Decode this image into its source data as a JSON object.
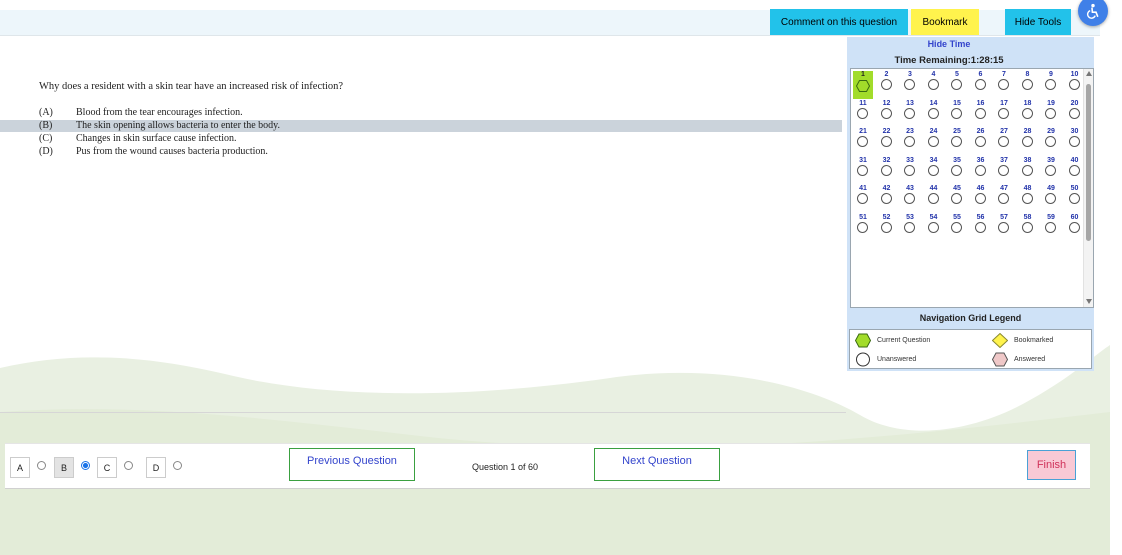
{
  "toolbar": {
    "comment_label": "Comment on this question",
    "bookmark_label": "Bookmark",
    "hide_tools_label": "Hide Tools"
  },
  "question": {
    "text": "Why does a resident with a skin tear have an increased risk of infection?",
    "options": [
      {
        "letter": "(A)",
        "text": "Blood from the tear encourages infection.",
        "selected": false
      },
      {
        "letter": "(B)",
        "text": "The skin opening allows bacteria to enter the body.",
        "selected": true
      },
      {
        "letter": "(C)",
        "text": "Changes in skin surface cause infection.",
        "selected": false
      },
      {
        "letter": "(D)",
        "text": "Pus from the wound causes bacteria production.",
        "selected": false
      }
    ]
  },
  "timer": {
    "hide_label": "Hide Time",
    "remaining_label": "Time Remaining:1:28:15"
  },
  "nav_grid": {
    "numbers": [
      "1",
      "2",
      "3",
      "4",
      "5",
      "6",
      "7",
      "8",
      "9",
      "10",
      "11",
      "12",
      "13",
      "14",
      "15",
      "16",
      "17",
      "18",
      "19",
      "20",
      "21",
      "22",
      "23",
      "24",
      "25",
      "26",
      "27",
      "28",
      "29",
      "30",
      "31",
      "32",
      "33",
      "34",
      "35",
      "36",
      "37",
      "38",
      "39",
      "40",
      "41",
      "42",
      "43",
      "44",
      "45",
      "46",
      "47",
      "48",
      "49",
      "50",
      "51",
      "52",
      "53",
      "54",
      "55",
      "56",
      "57",
      "58",
      "59",
      "60"
    ],
    "current": 1
  },
  "legend": {
    "title": "Navigation Grid Legend",
    "current": "Current Question",
    "bookmarked": "Bookmarked",
    "unanswered": "Unanswered",
    "answered": "Answered"
  },
  "answers": {
    "choices": [
      "A",
      "B",
      "C",
      "D"
    ],
    "selected": "B"
  },
  "nav": {
    "prev_label": "Previous Question",
    "next_label": "Next Question",
    "count_label": "Question 1 of 60",
    "finish_label": "Finish"
  },
  "colors": {
    "tool_button": "#22c2ea",
    "bookmark_button": "#fff34d",
    "current_question": "#a2dc2a",
    "panel": "#cfe2f7",
    "finish_button": "#f9c9d5",
    "accessibility": "#3f80e8"
  },
  "icons": {
    "accessibility": "accessibility-icon"
  }
}
